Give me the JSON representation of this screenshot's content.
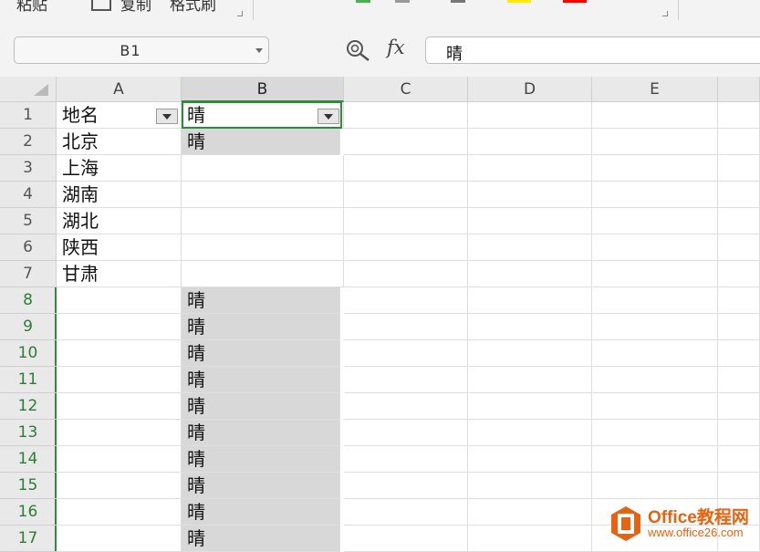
{
  "toolbar": {
    "paste_label": "粘贴",
    "copy_label": "复制",
    "format_painter_label": "格式刷"
  },
  "namebox": {
    "value": "B1"
  },
  "formula_bar": {
    "fx_label": "fx",
    "value": "晴"
  },
  "columns": [
    "A",
    "B",
    "C",
    "D",
    "E"
  ],
  "rows": [
    "1",
    "2",
    "3",
    "4",
    "5",
    "6",
    "7",
    "8",
    "9",
    "10",
    "11",
    "12",
    "13",
    "14",
    "15",
    "16",
    "17"
  ],
  "cells": {
    "A1": "地名",
    "A2": "北京",
    "A3": "上海",
    "A4": "湖南",
    "A5": "湖北",
    "A6": "陕西",
    "A7": "甘肃",
    "B1": "晴",
    "B2": "晴",
    "B8": "晴",
    "B9": "晴",
    "B10": "晴",
    "B11": "晴",
    "B12": "晴",
    "B13": "晴",
    "B14": "晴",
    "B15": "晴",
    "B16": "晴",
    "B17": "晴"
  },
  "selected_cell": "B1",
  "colors": {
    "accent_green": "#2e8b3a",
    "fill_gray": "#d8d8d8",
    "watermark_orange": "#e8620f"
  },
  "watermark": {
    "brand": "Office教程网",
    "url": "www.office26.com"
  }
}
